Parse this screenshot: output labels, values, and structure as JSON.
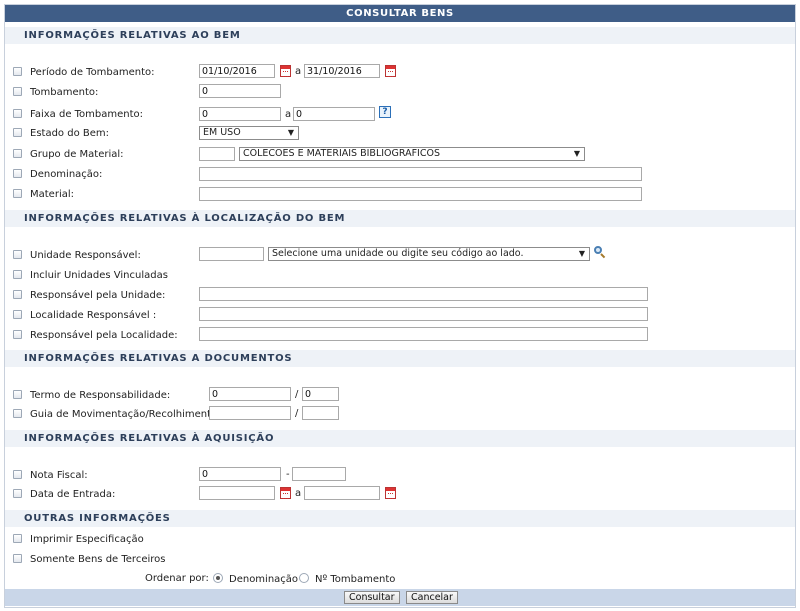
{
  "title": "Consultar Bens",
  "sections": {
    "bem": "Informações Relativas ao Bem",
    "localizacao": "Informações Relativas à Localização do Bem",
    "documentos": "Informações Relativas a Documentos",
    "aquisicao": "Informações Relativas à Aquisição",
    "outras": "Outras Informações"
  },
  "bem": {
    "periodo_label": "Período de Tombamento:",
    "periodo_inicio": "01/10/2016",
    "periodo_fim": "31/10/2016",
    "periodo_sep": "a",
    "tombamento_label": "Tombamento:",
    "tombamento_value": "0",
    "faixa_label": "Faixa de Tombamento:",
    "faixa_inicio": "0",
    "faixa_fim": "0",
    "faixa_sep": "a",
    "estado_label": "Estado do Bem:",
    "estado_value": "EM USO",
    "grupo_label": "Grupo de Material:",
    "grupo_codigo": "",
    "grupo_value": "COLECOES E MATERIAIS BIBLIOGRAFICOS",
    "denominacao_label": "Denominação:",
    "denominacao_value": "",
    "material_label": "Material:",
    "material_value": ""
  },
  "localizacao": {
    "unidade_label": "Unidade Responsável:",
    "unidade_codigo": "",
    "unidade_placeholder": "Selecione uma unidade ou digite seu código ao lado.",
    "incluir_label": "Incluir Unidades Vinculadas",
    "responsavel_unidade_label": "Responsável pela Unidade:",
    "localidade_label": "Localidade Responsável :",
    "responsavel_localidade_label": "Responsável pela Localidade:"
  },
  "documentos": {
    "termo_label": "Termo de Responsabilidade:",
    "termo_numero": "0",
    "termo_ano": "0",
    "guia_label": "Guia de Movimentação/Recolhimento:",
    "guia_numero": "",
    "guia_ano": "",
    "slash": "/"
  },
  "aquisicao": {
    "nota_label": "Nota Fiscal:",
    "nota_inicio": "0",
    "nota_fim": "",
    "nota_sep": "-",
    "data_label": "Data de Entrada:",
    "data_inicio": "",
    "data_fim": "",
    "data_sep": "a"
  },
  "outras": {
    "imprimir_label": "Imprimir Especificação",
    "terceiros_label": "Somente Bens de Terceiros",
    "ordenar_label": "Ordenar por:",
    "ordenar_opcao1": "Denominação",
    "ordenar_opcao2": "Nº Tombamento",
    "ordenar_selected": "Denominação"
  },
  "buttons": {
    "consultar": "Consultar",
    "cancelar": "Cancelar"
  },
  "colors": {
    "title_bar": "#3f5d87",
    "section_bg": "#eef2f7",
    "footer_bg": "#c9d6e8"
  },
  "icons": [
    "calendar-icon",
    "help-icon",
    "search-icon"
  ]
}
